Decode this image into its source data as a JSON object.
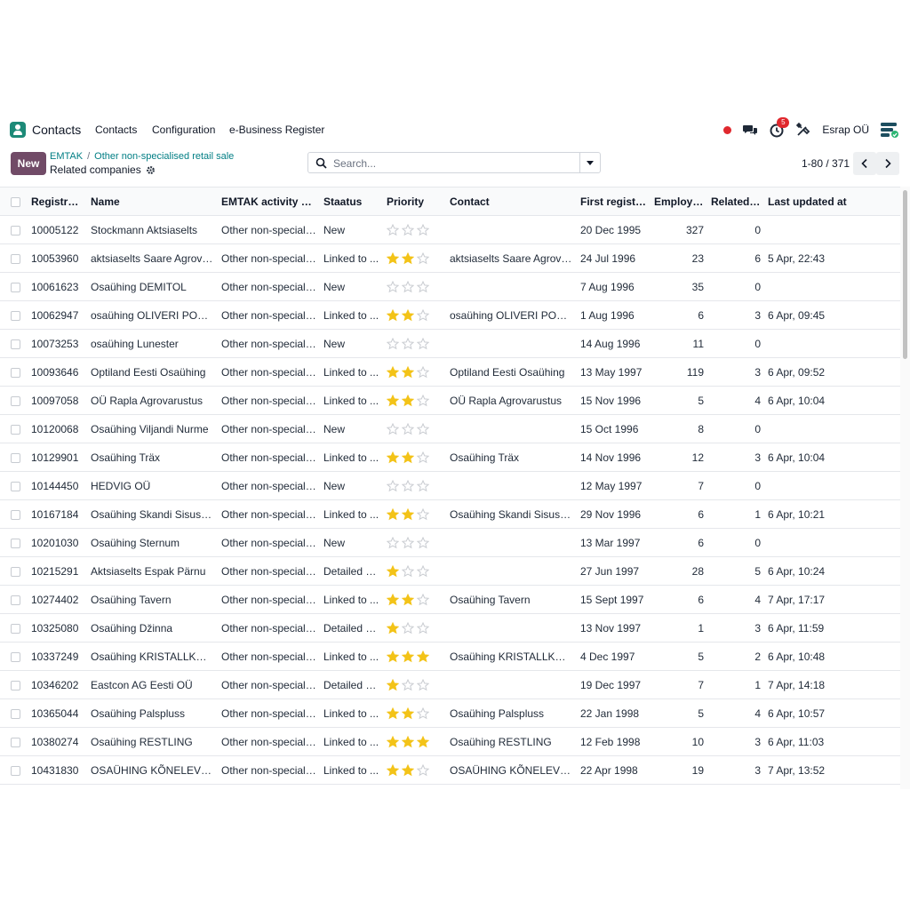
{
  "navbar": {
    "app_name": "Contacts",
    "menus": [
      "Contacts",
      "Configuration",
      "e-Business Register"
    ],
    "activity_count": "5",
    "company": "Esrap OÜ"
  },
  "control": {
    "new_label": "New",
    "breadcrumb": [
      "EMTAK",
      "Other non-specialised retail sale"
    ],
    "subtitle": "Related companies",
    "search_placeholder": "Search...",
    "pager": "1-80 / 371"
  },
  "table": {
    "columns": [
      "Registry .",
      "Name",
      "EMTAK activity na...",
      "Staatus",
      "Priority",
      "Contact",
      "First registr...",
      "Employe...",
      "Related ...",
      "Last updated at"
    ],
    "rows": [
      {
        "code": "10005122",
        "name": "Stockmann Aktsiaselts",
        "emtak": "Other non-speciali...",
        "status": "New",
        "priority": 0,
        "contact": "",
        "first": "20 Dec 1995",
        "employees": "327",
        "related": "0",
        "updated": ""
      },
      {
        "code": "10053960",
        "name": "aktsiaselts Saare Agrovaru",
        "emtak": "Other non-speciali...",
        "status": "Linked to ...",
        "priority": 2,
        "contact": "aktsiaselts Saare Agrovaru",
        "first": "24 Jul 1996",
        "employees": "23",
        "related": "6",
        "updated": "5 Apr, 22:43"
      },
      {
        "code": "10061623",
        "name": "Osaühing DEMITOL",
        "emtak": "Other non-speciali...",
        "status": "New",
        "priority": 0,
        "contact": "",
        "first": "7 Aug 1996",
        "employees": "35",
        "related": "0",
        "updated": ""
      },
      {
        "code": "10062947",
        "name": "osaühing OLIVERI POOD ...",
        "emtak": "Other non-speciali...",
        "status": "Linked to ...",
        "priority": 2,
        "contact": "osaühing OLIVERI POOD ...",
        "first": "1 Aug 1996",
        "employees": "6",
        "related": "3",
        "updated": "6 Apr, 09:45"
      },
      {
        "code": "10073253",
        "name": "osaühing Lunester",
        "emtak": "Other non-speciali...",
        "status": "New",
        "priority": 0,
        "contact": "",
        "first": "14 Aug 1996",
        "employees": "11",
        "related": "0",
        "updated": ""
      },
      {
        "code": "10093646",
        "name": "Optiland Eesti Osaühing",
        "emtak": "Other non-speciali...",
        "status": "Linked to ...",
        "priority": 2,
        "contact": "Optiland Eesti Osaühing",
        "first": "13 May 1997",
        "employees": "119",
        "related": "3",
        "updated": "6 Apr, 09:52"
      },
      {
        "code": "10097058",
        "name": "OÜ Rapla Agrovarustus",
        "emtak": "Other non-speciali...",
        "status": "Linked to ...",
        "priority": 2,
        "contact": "OÜ Rapla Agrovarustus",
        "first": "15 Nov 1996",
        "employees": "5",
        "related": "4",
        "updated": "6 Apr, 10:04"
      },
      {
        "code": "10120068",
        "name": "Osaühing Viljandi Nurme",
        "emtak": "Other non-speciali...",
        "status": "New",
        "priority": 0,
        "contact": "",
        "first": "15 Oct 1996",
        "employees": "8",
        "related": "0",
        "updated": ""
      },
      {
        "code": "10129901",
        "name": "Osaühing Träx",
        "emtak": "Other non-speciali...",
        "status": "Linked to ...",
        "priority": 2,
        "contact": "Osaühing Träx",
        "first": "14 Nov 1996",
        "employees": "12",
        "related": "3",
        "updated": "6 Apr, 10:04"
      },
      {
        "code": "10144450",
        "name": "HEDVIG OÜ",
        "emtak": "Other non-speciali...",
        "status": "New",
        "priority": 0,
        "contact": "",
        "first": "12 May 1997",
        "employees": "7",
        "related": "0",
        "updated": ""
      },
      {
        "code": "10167184",
        "name": "Osaühing Skandi Sisustus",
        "emtak": "Other non-speciali...",
        "status": "Linked to ...",
        "priority": 2,
        "contact": "Osaühing Skandi Sisustus",
        "first": "29 Nov 1996",
        "employees": "6",
        "related": "1",
        "updated": "6 Apr, 10:21"
      },
      {
        "code": "10201030",
        "name": "Osaühing Sternum",
        "emtak": "Other non-speciali...",
        "status": "New",
        "priority": 0,
        "contact": "",
        "first": "13 Mar 1997",
        "employees": "6",
        "related": "0",
        "updated": ""
      },
      {
        "code": "10215291",
        "name": "Aktsiaselts Espak Pärnu",
        "emtak": "Other non-speciali...",
        "status": "Detailed d...",
        "priority": 1,
        "contact": "",
        "first": "27 Jun 1997",
        "employees": "28",
        "related": "5",
        "updated": "6 Apr, 10:24"
      },
      {
        "code": "10274402",
        "name": "Osaühing Tavern",
        "emtak": "Other non-speciali...",
        "status": "Linked to ...",
        "priority": 2,
        "contact": "Osaühing Tavern",
        "first": "15 Sept 1997",
        "employees": "6",
        "related": "4",
        "updated": "7 Apr, 17:17"
      },
      {
        "code": "10325080",
        "name": "Osaühing Džinna",
        "emtak": "Other non-speciali...",
        "status": "Detailed d...",
        "priority": 1,
        "contact": "",
        "first": "13 Nov 1997",
        "employees": "1",
        "related": "3",
        "updated": "6 Apr, 11:59"
      },
      {
        "code": "10337249",
        "name": "Osaühing KRISTALLKOT...",
        "emtak": "Other non-speciali...",
        "status": "Linked to ...",
        "priority": 3,
        "contact": "Osaühing KRISTALLKOT...",
        "first": "4 Dec 1997",
        "employees": "5",
        "related": "2",
        "updated": "6 Apr, 10:48"
      },
      {
        "code": "10346202",
        "name": "Eastcon AG Eesti OÜ",
        "emtak": "Other non-speciali...",
        "status": "Detailed d...",
        "priority": 1,
        "contact": "",
        "first": "19 Dec 1997",
        "employees": "7",
        "related": "1",
        "updated": "7 Apr, 14:18"
      },
      {
        "code": "10365044",
        "name": "Osaühing Palspluss",
        "emtak": "Other non-speciali...",
        "status": "Linked to ...",
        "priority": 2,
        "contact": "Osaühing Palspluss",
        "first": "22 Jan 1998",
        "employees": "5",
        "related": "4",
        "updated": "6 Apr, 10:57"
      },
      {
        "code": "10380274",
        "name": "Osaühing RESTLING",
        "emtak": "Other non-speciali...",
        "status": "Linked to ...",
        "priority": 3,
        "contact": "Osaühing RESTLING",
        "first": "12 Feb 1998",
        "employees": "10",
        "related": "3",
        "updated": "6 Apr, 11:03"
      },
      {
        "code": "10431830",
        "name": "OSAÜHING KÕNELEV TR...",
        "emtak": "Other non-speciali...",
        "status": "Linked to ...",
        "priority": 2,
        "contact": "OSAÜHING KÕNELEV TR...",
        "first": "22 Apr 1998",
        "employees": "19",
        "related": "3",
        "updated": "7 Apr, 13:52"
      }
    ]
  },
  "colors": {
    "brand": "#714b67",
    "link": "#017e84",
    "star_on": "#f3c318",
    "star_off": "#c9ccd1",
    "alert": "#e0282e"
  }
}
